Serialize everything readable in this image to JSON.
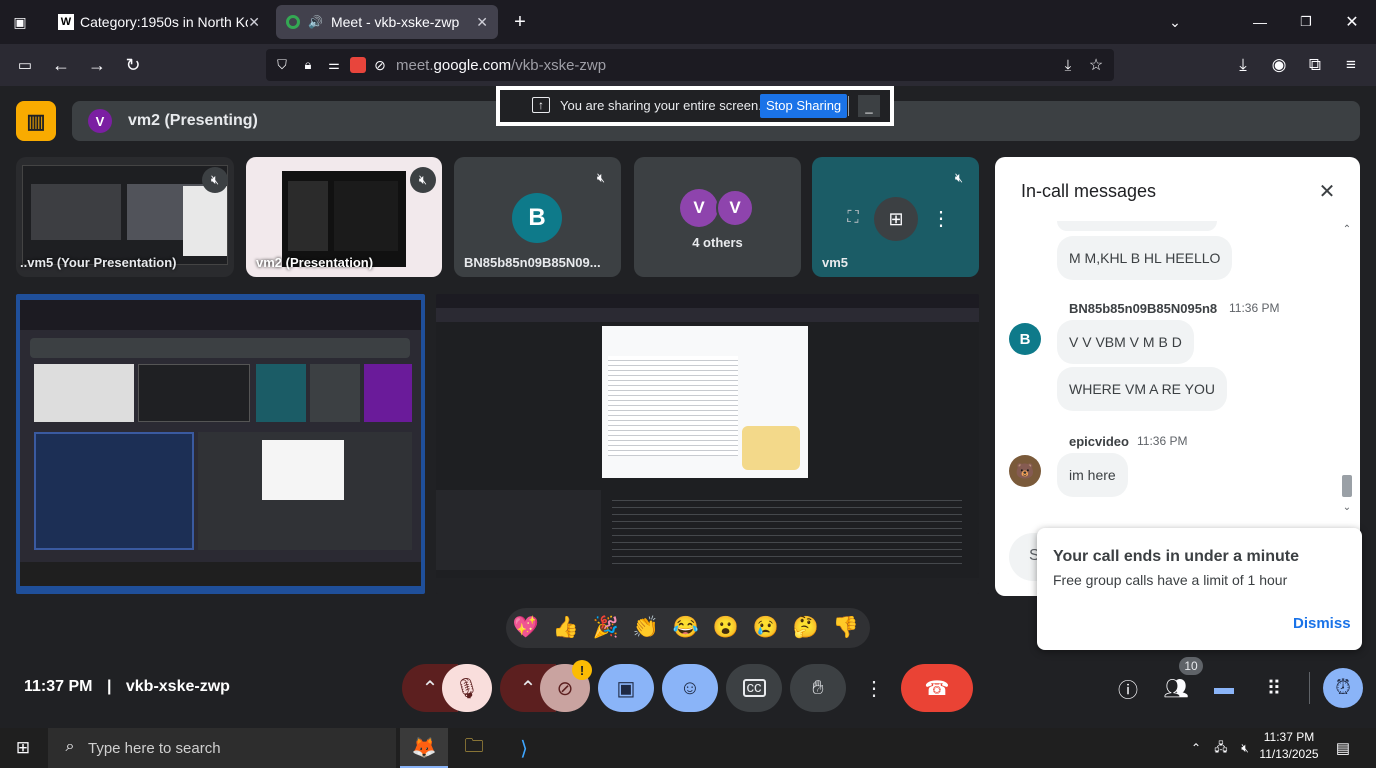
{
  "browser": {
    "tabs": [
      {
        "title": "Category:1950s in North Korea",
        "icon": "wikipedia-icon"
      },
      {
        "title": "Meet - vkb-xske-zwp",
        "icon": "meet-icon"
      }
    ],
    "url_prefix": "meet.",
    "url_domain": "google.com",
    "url_path": "/vkb-xske-zwp"
  },
  "sharing_bar": {
    "text": "You are sharing your entire screen.",
    "stop_label": "Stop Sharing"
  },
  "presenting": {
    "avatar_letter": "V",
    "label": "vm2 (Presenting)"
  },
  "top_tiles": [
    {
      "label": "..vm5 (Your Presentation)"
    },
    {
      "label": "vm2 (Presentation)"
    },
    {
      "label": "BN85b85n09B85N09...",
      "letter": "B"
    },
    {
      "label": "4 others",
      "letters": [
        "V",
        "V"
      ]
    },
    {
      "label": "vm5"
    }
  ],
  "chat": {
    "title": "In-call messages",
    "messages": [
      {
        "text": "M M,KHL B  HL  HEELLO"
      },
      {
        "sender": "BN85b85n09B85N095n8",
        "time": "11:36 PM",
        "letter": "B"
      },
      {
        "text": "V    V VBM V M  B D"
      },
      {
        "text": "WHERE    VM A RE  YOU"
      },
      {
        "sender": "epicvideo",
        "time": "11:36 PM"
      },
      {
        "text": "im here"
      }
    ],
    "input_initial": "S"
  },
  "toast": {
    "title": "Your call ends in under a minute",
    "body": "Free group calls have a limit of 1 hour",
    "dismiss": "Dismiss"
  },
  "reactions": [
    "💖",
    "👍",
    "🎉",
    "👏",
    "😂",
    "😮",
    "😢",
    "🤔",
    "👎"
  ],
  "bottom": {
    "time": "11:37 PM",
    "separator": "|",
    "meeting_code": "vkb-xske-zwp",
    "people_count": "10",
    "warning": "!"
  },
  "taskbar": {
    "search_placeholder": "Type here to search",
    "time": "11:37 PM",
    "date": "11/13/2025"
  },
  "colors": {
    "accent": "#8ab4f8",
    "end_call": "#ea4335",
    "share_bar": "#1a73e8",
    "logo_bg": "#f9ab00"
  }
}
